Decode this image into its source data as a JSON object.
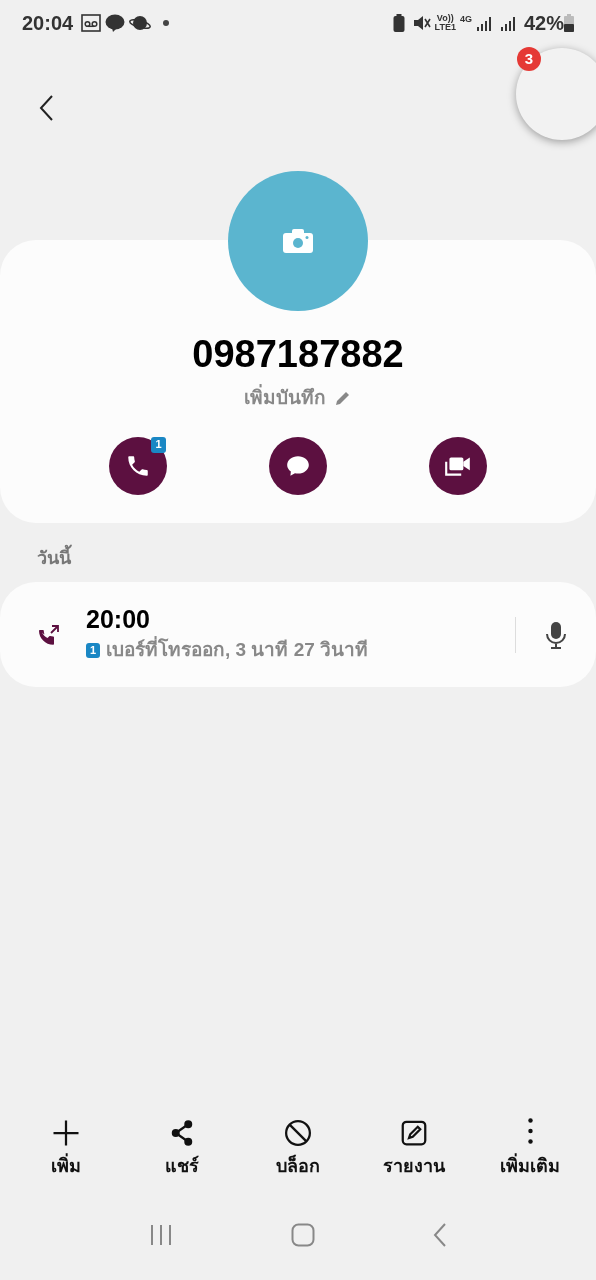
{
  "status_bar": {
    "time": "20:04",
    "volte_top": "Vo))",
    "volte_bottom": "LTE1",
    "network": "4G",
    "battery": "42%"
  },
  "floating_badge": "3",
  "contact": {
    "number": "0987187882",
    "note": "เพิ่มบันทึก",
    "call_sim_badge": "1"
  },
  "actions": [
    {
      "kind": "call"
    },
    {
      "kind": "message"
    },
    {
      "kind": "video"
    }
  ],
  "section_label": "วันนี้",
  "call_log": [
    {
      "time": "20:00",
      "sim": "1",
      "detail": "เบอร์ที่โทรออก, 3 นาที 27 วินาที"
    }
  ],
  "toolbar": [
    {
      "kind": "add",
      "label": "เพิ่ม"
    },
    {
      "kind": "share",
      "label": "แชร์"
    },
    {
      "kind": "block",
      "label": "บล็อก"
    },
    {
      "kind": "report",
      "label": "รายงาน"
    },
    {
      "kind": "more",
      "label": "เพิ่มเติม"
    }
  ]
}
